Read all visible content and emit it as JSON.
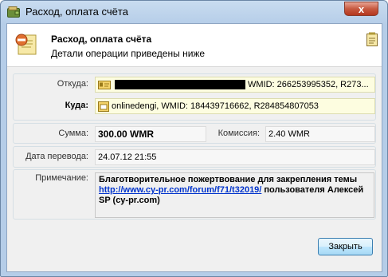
{
  "window": {
    "title": "Расход, оплата счёта",
    "close_glyph": "x"
  },
  "header": {
    "title": "Расход, оплата счёта",
    "subtitle": "Детали операции приведены ниже",
    "icon": "invoice-payment-icon",
    "help_icon": "notes-icon"
  },
  "fields": {
    "from_label": "Откуда:",
    "from_value": "WMID: 266253995352, R273...",
    "to_label": "Куда:",
    "to_value": "onlinedengi, WMID: 184439716662, R284854807053",
    "amount_label": "Сумма:",
    "amount_value": "300.00 WMR",
    "commission_label": "Комиссия:",
    "commission_value": "2.40 WMR",
    "date_label": "Дата перевода:",
    "date_value": "24.07.12 21:55",
    "note_label": "Примечание:",
    "note_text_1": "Благотворительное пожертвование для закрепления темы ",
    "note_link": "http://www.cy-pr.com/forum/f71/t32019/",
    "note_text_2": " пользователя Алексей SP (cy-pr.com)"
  },
  "buttons": {
    "close_label": "Закрыть"
  },
  "colors": {
    "link": "#0033cc",
    "title_bar": "#b5cde8",
    "close_button": "#c75a41",
    "yellow_field": "#fdfde0"
  }
}
